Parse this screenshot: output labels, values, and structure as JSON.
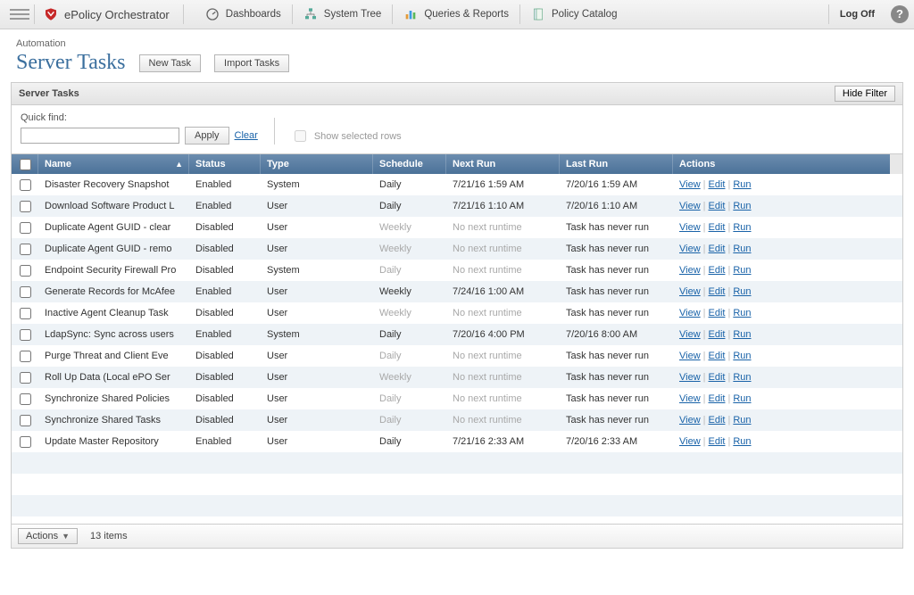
{
  "topbar": {
    "brand": "ePolicy Orchestrator",
    "nav": [
      {
        "label": "Dashboards"
      },
      {
        "label": "System Tree"
      },
      {
        "label": "Queries & Reports"
      },
      {
        "label": "Policy Catalog"
      }
    ],
    "logoff": "Log Off"
  },
  "header": {
    "breadcrumb": "Automation",
    "title": "Server Tasks",
    "new_task": "New Task",
    "import_tasks": "Import Tasks"
  },
  "panel": {
    "title": "Server Tasks",
    "hide_filter": "Hide Filter",
    "quick_find_label": "Quick find:",
    "apply": "Apply",
    "clear": "Clear",
    "show_selected": "Show selected rows"
  },
  "table": {
    "columns": {
      "name": "Name",
      "status": "Status",
      "type": "Type",
      "schedule": "Schedule",
      "next": "Next Run",
      "last": "Last Run",
      "actions": "Actions"
    },
    "actions": {
      "view": "View",
      "edit": "Edit",
      "run": "Run"
    },
    "rows": [
      {
        "name": "Disaster Recovery Snapshot",
        "status": "Enabled",
        "type": "System",
        "schedule": "Daily",
        "next": "7/21/16 1:59 AM",
        "last": "7/20/16 1:59 AM"
      },
      {
        "name": "Download Software Product L",
        "status": "Enabled",
        "type": "User",
        "schedule": "Daily",
        "next": "7/21/16 1:10 AM",
        "last": "7/20/16 1:10 AM"
      },
      {
        "name": "Duplicate Agent GUID - clear",
        "status": "Disabled",
        "type": "User",
        "schedule": "Weekly",
        "next": "No next runtime",
        "last": "Task has never run"
      },
      {
        "name": "Duplicate Agent GUID - remo",
        "status": "Disabled",
        "type": "User",
        "schedule": "Weekly",
        "next": "No next runtime",
        "last": "Task has never run"
      },
      {
        "name": "Endpoint Security Firewall Pro",
        "status": "Disabled",
        "type": "System",
        "schedule": "Daily",
        "next": "No next runtime",
        "last": "Task has never run"
      },
      {
        "name": "Generate Records for McAfee",
        "status": "Enabled",
        "type": "User",
        "schedule": "Weekly",
        "next": "7/24/16 1:00 AM",
        "last": "Task has never run"
      },
      {
        "name": "Inactive Agent Cleanup Task",
        "status": "Disabled",
        "type": "User",
        "schedule": "Weekly",
        "next": "No next runtime",
        "last": "Task has never run"
      },
      {
        "name": "LdapSync: Sync across users",
        "status": "Enabled",
        "type": "System",
        "schedule": "Daily",
        "next": "7/20/16 4:00 PM",
        "last": "7/20/16 8:00 AM"
      },
      {
        "name": "Purge Threat and Client Eve",
        "status": "Disabled",
        "type": "User",
        "schedule": "Daily",
        "next": "No next runtime",
        "last": "Task has never run"
      },
      {
        "name": "Roll Up Data (Local ePO Ser",
        "status": "Disabled",
        "type": "User",
        "schedule": "Weekly",
        "next": "No next runtime",
        "last": "Task has never run"
      },
      {
        "name": "Synchronize Shared Policies",
        "status": "Disabled",
        "type": "User",
        "schedule": "Daily",
        "next": "No next runtime",
        "last": "Task has never run"
      },
      {
        "name": "Synchronize Shared Tasks",
        "status": "Disabled",
        "type": "User",
        "schedule": "Daily",
        "next": "No next runtime",
        "last": "Task has never run"
      },
      {
        "name": "Update Master Repository",
        "status": "Enabled",
        "type": "User",
        "schedule": "Daily",
        "next": "7/21/16 2:33 AM",
        "last": "7/20/16 2:33 AM"
      }
    ],
    "empty_rows": 4
  },
  "footer": {
    "actions": "Actions",
    "count": "13 items"
  }
}
